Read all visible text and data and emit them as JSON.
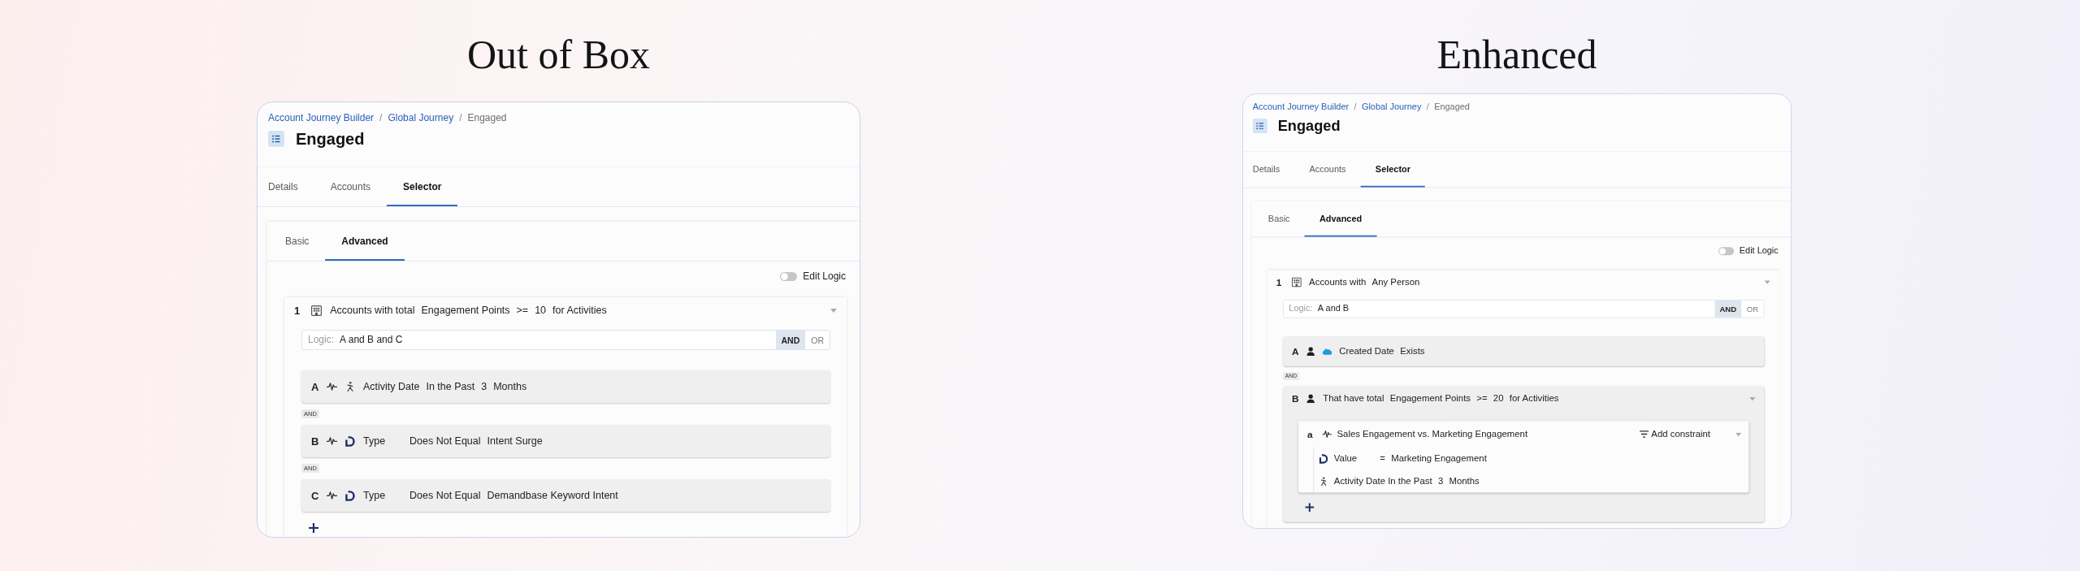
{
  "panels": [
    {
      "heading": "Out of Box",
      "breadcrumb": [
        {
          "kind": "link",
          "label": "Account Journey Builder"
        },
        {
          "kind": "separator",
          "label": "/"
        },
        {
          "kind": "link",
          "label": "Global Journey"
        },
        {
          "kind": "separator",
          "label": "/"
        },
        {
          "kind": "current",
          "label": "Engaged"
        }
      ],
      "title": "Engaged",
      "tabs": [
        {
          "label": "Details",
          "selected": false
        },
        {
          "label": "Accounts",
          "selected": false
        },
        {
          "label": "Selector",
          "selected": true
        }
      ],
      "subtabs": [
        {
          "label": "Basic",
          "selected": false
        },
        {
          "label": "Advanced",
          "selected": true
        }
      ],
      "edit_logic": {
        "label": "Edit Logic",
        "on": false
      },
      "rule": {
        "number": "1",
        "terms": [
          "Accounts with total",
          "Engagement Points",
          ">=",
          "10",
          "for Activities"
        ],
        "logic": {
          "label": "Logic:",
          "value": "A and B and C",
          "operators": [
            {
              "label": "AND",
              "selected": true
            },
            {
              "label": "OR",
              "selected": false
            }
          ]
        },
        "items": [
          {
            "kind": "timeframe",
            "letter": "A",
            "terms": [
              "Activity Date",
              "In the Past",
              "3",
              "Months"
            ]
          },
          {
            "kind": "joiner",
            "label": "AND"
          },
          {
            "kind": "intent",
            "letter": "B",
            "terms": [
              "Type",
              "Does Not Equal",
              "Intent Surge"
            ]
          },
          {
            "kind": "joiner",
            "label": "AND"
          },
          {
            "kind": "intent",
            "letter": "C",
            "terms": [
              "Type",
              "Does Not Equal",
              "Demandbase Keyword Intent"
            ]
          }
        ],
        "add_button": true
      }
    },
    {
      "heading": "Enhanced",
      "breadcrumb": [
        {
          "kind": "link",
          "label": "Account Journey Builder"
        },
        {
          "kind": "separator",
          "label": "/"
        },
        {
          "kind": "link",
          "label": "Global Journey"
        },
        {
          "kind": "separator",
          "label": "/"
        },
        {
          "kind": "current",
          "label": "Engaged"
        }
      ],
      "title": "Engaged",
      "tabs": [
        {
          "label": "Details",
          "selected": false
        },
        {
          "label": "Accounts",
          "selected": false
        },
        {
          "label": "Selector",
          "selected": true
        }
      ],
      "subtabs": [
        {
          "label": "Basic",
          "selected": false
        },
        {
          "label": "Advanced",
          "selected": true
        }
      ],
      "edit_logic": {
        "label": "Edit Logic",
        "on": false
      },
      "rule": {
        "number": "1",
        "terms": [
          "Accounts with",
          "Any Person"
        ],
        "logic": {
          "label": "Logic:",
          "value": "A and B",
          "operators": [
            {
              "label": "AND",
              "selected": true
            },
            {
              "label": "OR",
              "selected": false
            }
          ]
        },
        "items": [
          {
            "kind": "crm",
            "letter": "A",
            "terms": [
              "Created Date",
              "Exists"
            ]
          },
          {
            "kind": "joiner",
            "label": "AND"
          },
          {
            "kind": "person",
            "letter": "B",
            "terms": [
              "That have total",
              "Engagement Points",
              ">=",
              "20",
              "for Activities"
            ],
            "add_button": true,
            "children": [
              {
                "kind": "activity",
                "letter": "a",
                "title": "Sales Engagement vs. Marketing Engagement",
                "action": "Add constraint",
                "lines": [
                  {
                    "kind": "attribute",
                    "terms": [
                      "Value",
                      "=",
                      "Marketing Engagement"
                    ]
                  },
                  {
                    "kind": "timeframe",
                    "terms": [
                      "Activity Date In the Past",
                      "3",
                      "Months"
                    ]
                  }
                ]
              }
            ]
          }
        ]
      }
    }
  ]
}
